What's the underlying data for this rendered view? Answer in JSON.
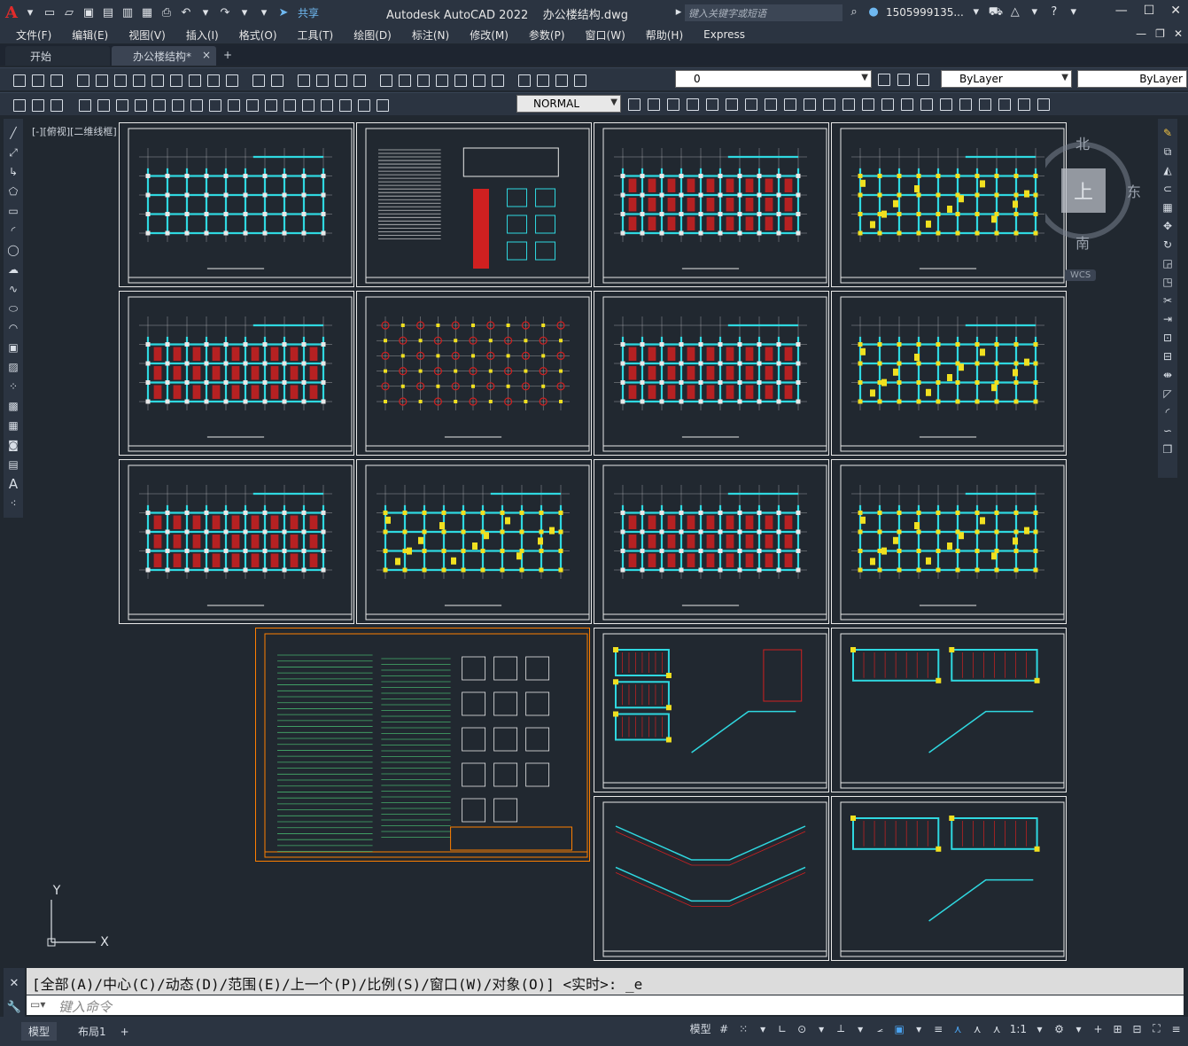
{
  "app": {
    "logo": "A",
    "title": "Autodesk AutoCAD 2022",
    "filename": "办公楼结构.dwg",
    "share_label": "共享",
    "search_placeholder": "键入关键字或短语",
    "user": "1505999135...",
    "help": "?"
  },
  "menu": [
    "文件(F)",
    "编辑(E)",
    "视图(V)",
    "插入(I)",
    "格式(O)",
    "工具(T)",
    "绘图(D)",
    "标注(N)",
    "修改(M)",
    "参数(P)",
    "窗口(W)",
    "帮助(H)",
    "Express"
  ],
  "tabs": {
    "start": "开始",
    "active": "办公楼结构*",
    "close": "×",
    "add": "+"
  },
  "layer": {
    "current": "0",
    "color": "ByLayer",
    "linetype": "ByLayer"
  },
  "style": {
    "dimstyle": "NORMAL"
  },
  "viewport_label": "[-][俯视][二维线框]",
  "viewcube": {
    "north": "北",
    "south": "南",
    "east": "东",
    "top": "上",
    "wcs": "WCS"
  },
  "ucs": {
    "x": "X",
    "y": "Y"
  },
  "sheets": {
    "plan_color": "#2fd8e0",
    "rebar_color": "#d02020",
    "column_color": "#f0e020",
    "notes_color": "#4fd07a",
    "frame_color": "#e8e8e8",
    "highlight_color": "#ff7f00"
  },
  "command": {
    "history": "[全部(A)/中心(C)/动态(D)/范围(E)/上一个(P)/比例(S)/窗口(W)/对象(O)] <实时>: _e",
    "placeholder": "键入命令"
  },
  "layout_tabs": {
    "model": "模型",
    "layout1": "布局1",
    "add": "+"
  },
  "status": {
    "model_label": "模型",
    "scale": "1:1"
  }
}
